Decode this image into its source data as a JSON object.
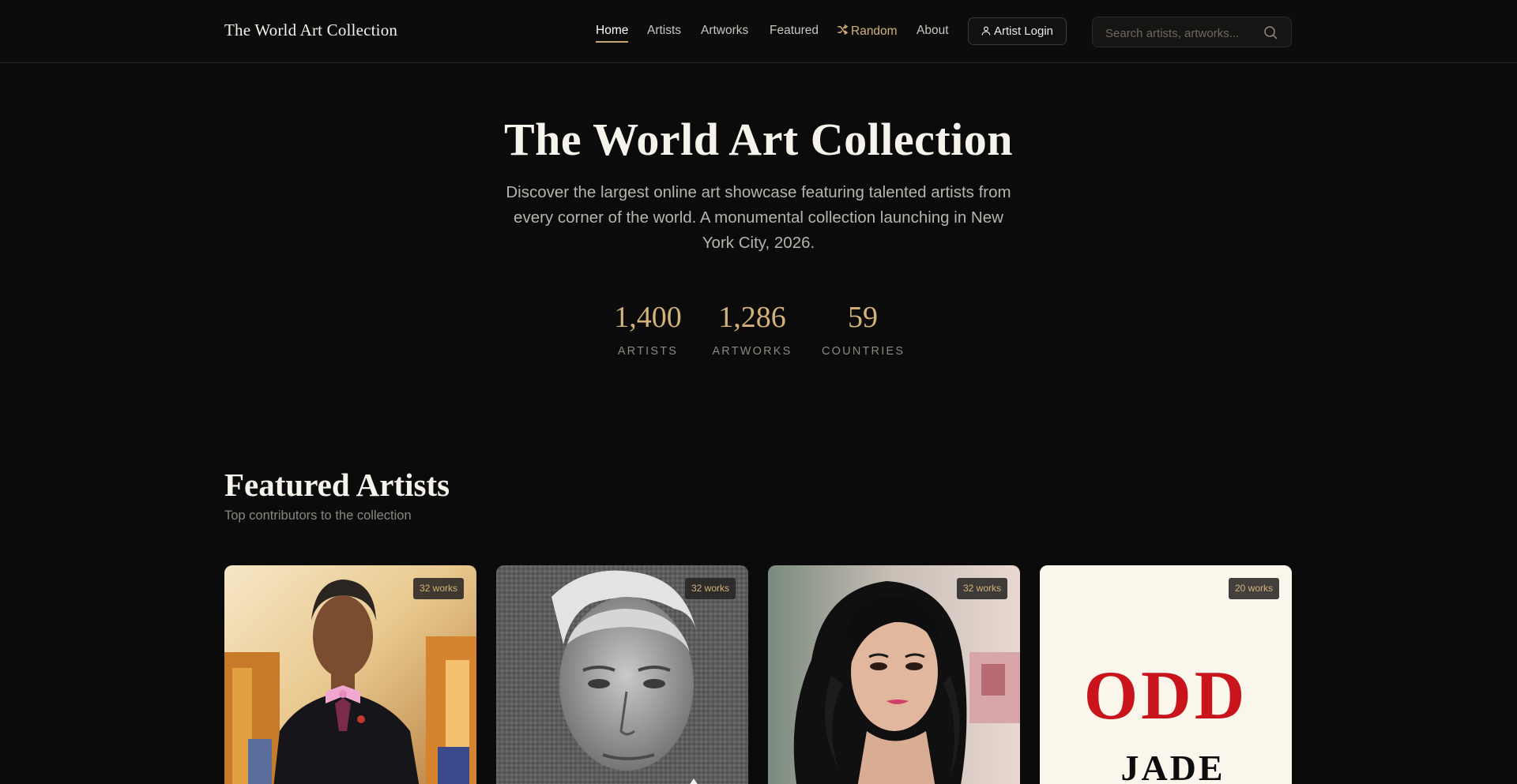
{
  "header": {
    "brand": "The World Art Collection",
    "nav": [
      {
        "label": "Home",
        "active": true
      },
      {
        "label": "Artists"
      },
      {
        "label": "Artworks"
      },
      {
        "label": "Featured"
      },
      {
        "label": "Random",
        "icon": "shuffle-icon"
      },
      {
        "label": "About"
      }
    ],
    "login_label": "Artist Login",
    "search_placeholder": "Search artists, artworks..."
  },
  "hero": {
    "title": "The World Art Collection",
    "subtitle": "Discover the largest online art showcase featuring talented artists from every corner of the world. A monumental collection launching in New York City, 2026.",
    "stats": [
      {
        "value": "1,400",
        "label": "ARTISTS"
      },
      {
        "value": "1,286",
        "label": "ARTWORKS"
      },
      {
        "value": "59",
        "label": "COUNTRIES"
      }
    ]
  },
  "featured": {
    "title": "Featured Artists",
    "subtitle": "Top contributors to the collection",
    "cards": [
      {
        "badge": "32 works"
      },
      {
        "badge": "32 works"
      },
      {
        "badge": "32 works"
      },
      {
        "badge": "20 works",
        "poster_line1": "ODD",
        "poster_line2": "JADE"
      }
    ]
  },
  "colors": {
    "background": "#0c0b0b",
    "accent_gold": "#d3b27a",
    "poster_red": "#c8141a"
  }
}
